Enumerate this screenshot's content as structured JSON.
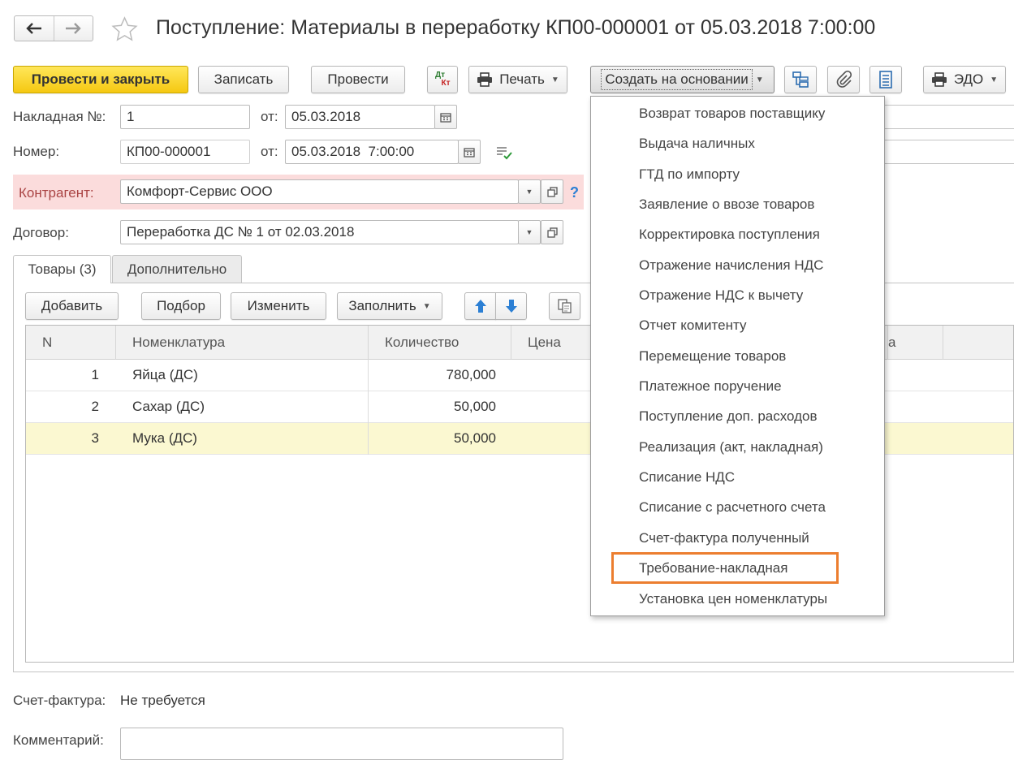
{
  "window": {
    "title": "Поступление: Материалы в переработку КП00-000001 от 05.03.2018 7:00:00"
  },
  "toolbar": {
    "post_close": "Провести и закрыть",
    "save": "Записать",
    "post": "Провести",
    "dt_label": "Дт",
    "kt_label": "Кт",
    "print": "Печать",
    "create_based": "Создать на основании",
    "edo": "ЭДО"
  },
  "form": {
    "invoice_label": "Накладная №:",
    "invoice_value": "1",
    "from_label": "от:",
    "invoice_date": "05.03.2018",
    "number_label": "Номер:",
    "number_value": "КП00-000001",
    "number_date": "05.03.2018  7:00:00",
    "counterparty_label": "Контрагент:",
    "counterparty_value": "Комфорт-Сервис ООО",
    "help": "?",
    "contract_label": "Договор:",
    "contract_value": "Переработка ДС № 1 от 02.03.2018"
  },
  "tabs": [
    {
      "label": "Товары (3)"
    },
    {
      "label": "Дополнительно"
    }
  ],
  "table_toolbar": {
    "add": "Добавить",
    "select": "Подбор",
    "edit": "Изменить",
    "fill": "Заполнить"
  },
  "table": {
    "headers": [
      "N",
      "Номенклатура",
      "Количество",
      "Цена",
      "а"
    ],
    "rows": [
      {
        "n": "1",
        "name": "Яйца (ДС)",
        "qty": "780,000"
      },
      {
        "n": "2",
        "name": "Сахар (ДС)",
        "qty": "50,000"
      },
      {
        "n": "3",
        "name": "Мука (ДС)",
        "qty": "50,000"
      }
    ]
  },
  "footer": {
    "invoice_label": "Счет-фактура:",
    "invoice_value": "Не требуется",
    "comment_label": "Комментарий:"
  },
  "dropdown": {
    "items": [
      "Возврат товаров поставщику",
      "Выдача наличных",
      "ГТД по импорту",
      "Заявление о ввозе товаров",
      "Корректировка поступления",
      "Отражение начисления НДС",
      "Отражение НДС к вычету",
      "Отчет комитенту",
      "Перемещение товаров",
      "Платежное поручение",
      "Поступление доп. расходов",
      "Реализация (акт, накладная)",
      "Списание НДС",
      "Списание с расчетного счета",
      "Счет-фактура полученный",
      "Требование-накладная",
      "Установка цен номенклатуры"
    ],
    "highlighted_index": 15,
    "highlight_color": "#ec7e2f"
  },
  "colors": {
    "primary_button": "#f5c811",
    "required_field_bg": "#fbdcdc",
    "selected_row_bg": "#fbf8d1",
    "arrow_blue": "#2b7fd4"
  }
}
